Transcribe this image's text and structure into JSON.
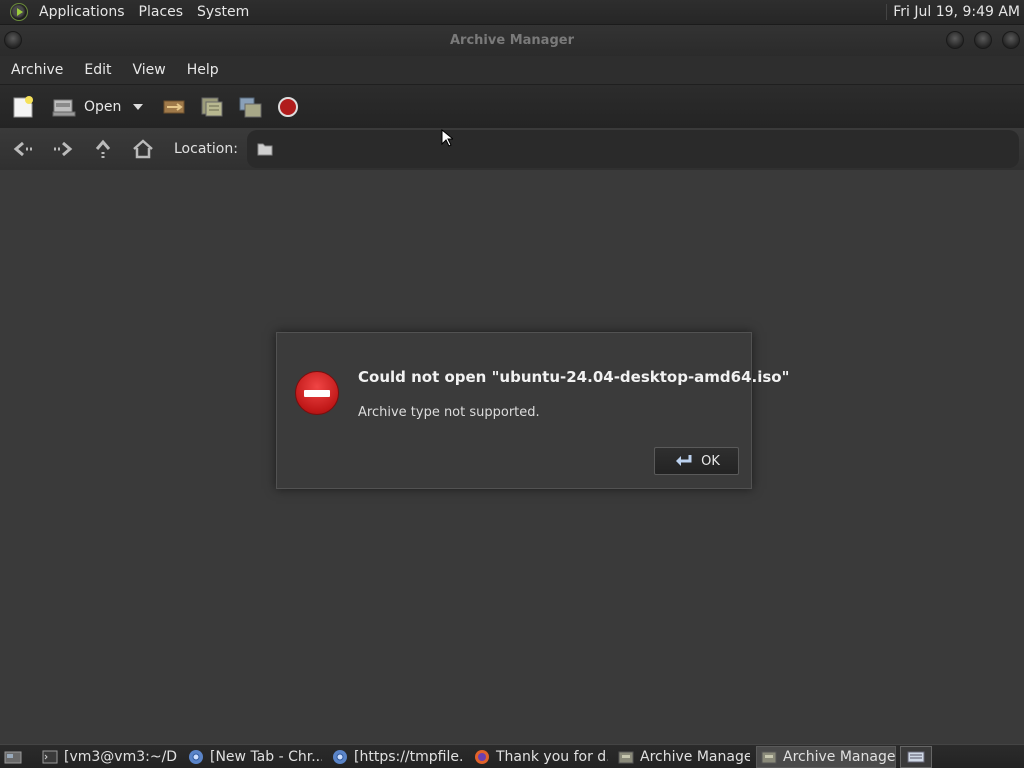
{
  "top_panel": {
    "menus": [
      "Applications",
      "Places",
      "System"
    ],
    "clock": "Fri Jul 19,  9:49 AM"
  },
  "window": {
    "title": "Archive Manager"
  },
  "menubar": {
    "items": [
      "Archive",
      "Edit",
      "View",
      "Help"
    ]
  },
  "toolbar": {
    "open_label": "Open"
  },
  "location": {
    "label": "Location:",
    "value": ""
  },
  "dialog": {
    "title": "Could not open \"ubuntu-24.04-desktop-amd64.iso\"",
    "message": "Archive type not supported.",
    "ok_label": "OK"
  },
  "taskbar": {
    "tasks": [
      {
        "label": "[vm3@vm3:~/D...",
        "icon": "terminal-icon"
      },
      {
        "label": "[New Tab - Chr...",
        "icon": "chromium-icon"
      },
      {
        "label": "[https://tmpfile...",
        "icon": "chromium-icon"
      },
      {
        "label": "Thank you for d...",
        "icon": "firefox-icon"
      },
      {
        "label": "Archive Manager",
        "icon": "archive-manager-icon"
      },
      {
        "label": "Archive Manager",
        "icon": "archive-manager-icon",
        "active": true
      }
    ]
  },
  "colors": {
    "background": "#3a3a3a",
    "error_red": "#d42a2a",
    "panel": "#2e2e2e"
  }
}
